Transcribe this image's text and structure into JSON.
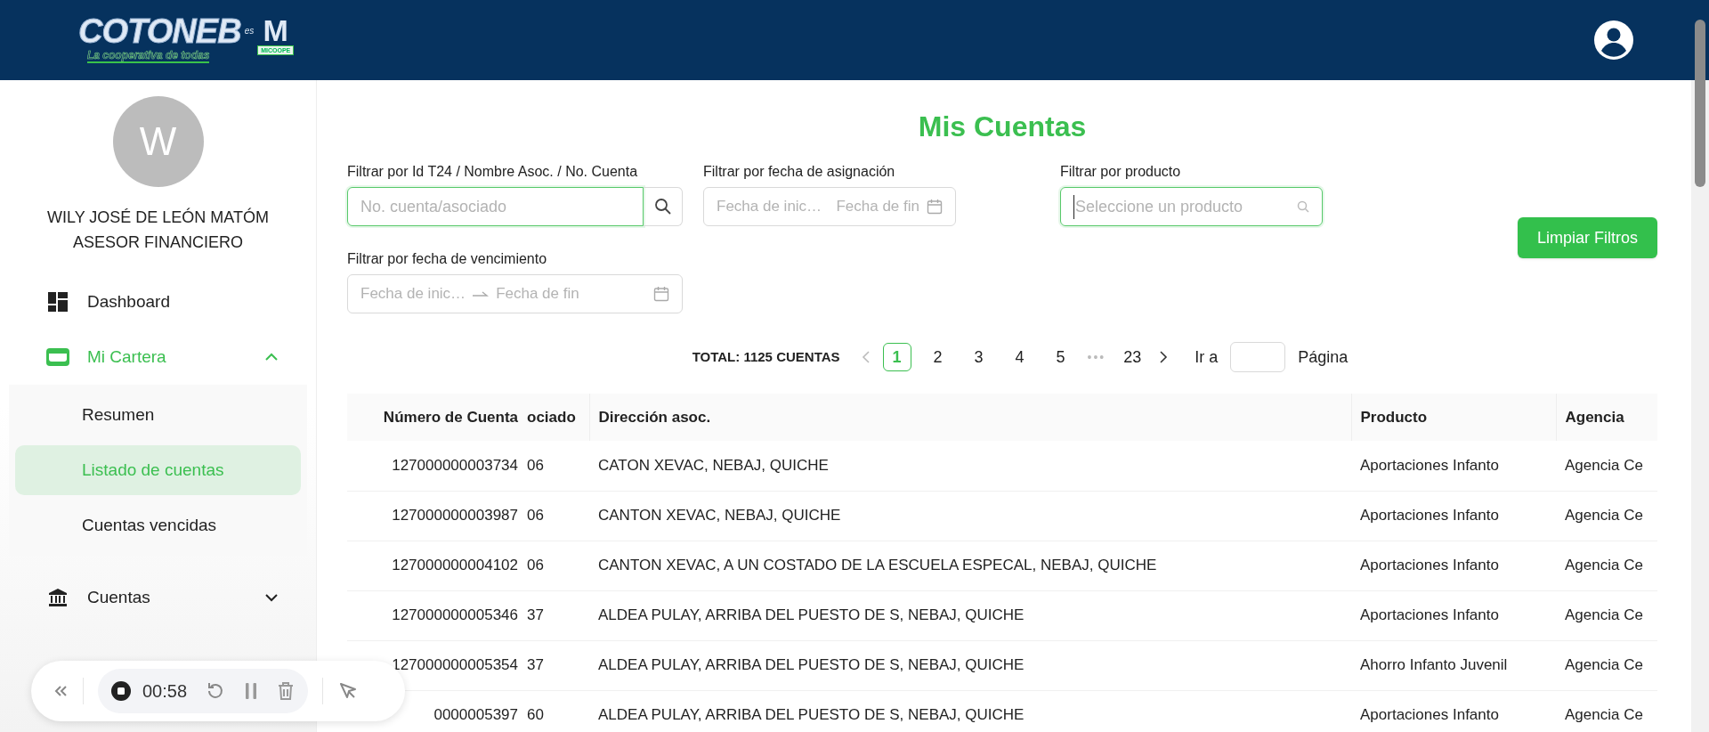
{
  "header": {
    "logo": {
      "name": "COTONEB",
      "connector": "es",
      "badge_letter": "M",
      "badge_text": "MICOOPE",
      "slogan": "La cooperativa de todas"
    }
  },
  "profile": {
    "initial": "W",
    "name": "WILY JOSÉ DE LEÓN MATÓM",
    "role": "ASESOR FINANCIERO"
  },
  "nav": [
    {
      "kind": "link",
      "label": "Dashboard",
      "selected": false
    },
    {
      "kind": "group",
      "label": "Mi Cartera",
      "selected": true,
      "expanded": true,
      "children": [
        {
          "label": "Resumen",
          "selected": false
        },
        {
          "label": "Listado de cuentas",
          "selected": true
        },
        {
          "label": "Cuentas vencidas",
          "selected": false
        }
      ]
    },
    {
      "kind": "group",
      "label": "Cuentas",
      "selected": false,
      "expanded": false
    }
  ],
  "page_title": "Mis Cuentas",
  "filters": [
    {
      "kind": "search",
      "label": "Filtrar por Id T24 / Nombre Asoc. / No. Cuenta",
      "placeholder": "No. cuenta/asociado",
      "focused": true
    },
    {
      "kind": "range",
      "label": "Filtrar por fecha de asignación",
      "placeholder_start": "Fecha de inic…",
      "placeholder_end": "Fecha de fin",
      "focused": false
    },
    {
      "kind": "select",
      "label": "Filtrar por producto",
      "placeholder": "Seleccione un producto",
      "focused": true
    },
    {
      "kind": "range",
      "label": "Filtrar por fecha de vencimiento",
      "placeholder_start": "Fecha de inic…",
      "placeholder_end": "Fecha de fin",
      "focused": false
    }
  ],
  "clear_button": "Limpiar Filtros",
  "pagination": {
    "total": "TOTAL: 1125 CUENTAS",
    "pages": [
      {
        "label": "1",
        "selected": true
      },
      {
        "label": "2",
        "selected": false
      },
      {
        "label": "3",
        "selected": false
      },
      {
        "label": "4",
        "selected": false
      },
      {
        "label": "5",
        "selected": false
      }
    ],
    "ellipsis": "•••",
    "last_page": "23",
    "jump_label": "Ir a",
    "jump_suffix": "Página"
  },
  "table": {
    "columns": [
      "Número de Cuenta",
      "ociado",
      "Dirección asoc.",
      "Producto",
      "Agencia"
    ],
    "rows": [
      [
        "127000000003734",
        "06",
        "CATON XEVAC, NEBAJ, QUICHE",
        "Aportaciones Infanto",
        "Agencia Ce"
      ],
      [
        "127000000003987",
        "06",
        "CANTON XEVAC, NEBAJ, QUICHE",
        "Aportaciones Infanto",
        "Agencia Ce"
      ],
      [
        "127000000004102",
        "06",
        "CANTON XEVAC, A UN COSTADO DE LA ESCUELA ESPECAL, NEBAJ, QUICHE",
        "Aportaciones Infanto",
        "Agencia Ce"
      ],
      [
        "127000000005346",
        "37",
        "ALDEA PULAY, ARRIBA DEL PUESTO DE S, NEBAJ, QUICHE",
        "Aportaciones Infanto",
        "Agencia Ce"
      ],
      [
        "127000000005354",
        "37",
        "ALDEA PULAY, ARRIBA DEL PUESTO DE S, NEBAJ, QUICHE",
        "Ahorro Infanto Juvenil",
        "Agencia Ce"
      ],
      [
        "0000005397",
        "60",
        "ALDEA PULAY, ARRIBA DEL PUESTO DE S, NEBAJ, QUICHE",
        "Aportaciones Infanto",
        "Agencia Ce"
      ]
    ]
  },
  "recorder": {
    "time": "00:58",
    "recording": true
  }
}
